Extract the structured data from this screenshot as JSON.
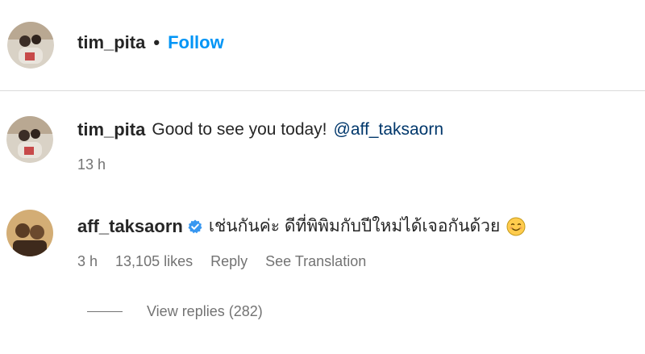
{
  "post_header": {
    "username": "tim_pita",
    "separator": "•",
    "follow_label": "Follow"
  },
  "comments": [
    {
      "username": "tim_pita",
      "text": "Good to see you today!",
      "mention": "@aff_taksaorn",
      "time": "13 h"
    },
    {
      "username": "aff_taksaorn",
      "verified": true,
      "text": "เช่นกันค่ะ ดีที่พิพิมกับปีใหม่ได้เจอกันด้วย",
      "emoji": "smiling-face-emoji",
      "time": "3 h",
      "likes": "13,105 likes",
      "reply_label": "Reply",
      "translation_label": "See Translation"
    }
  ],
  "view_replies_label": "View replies (282)",
  "colors": {
    "link_blue": "#0095f6",
    "mention_blue": "#00376b",
    "verified_blue": "#3897f0",
    "meta_gray": "#737373"
  }
}
